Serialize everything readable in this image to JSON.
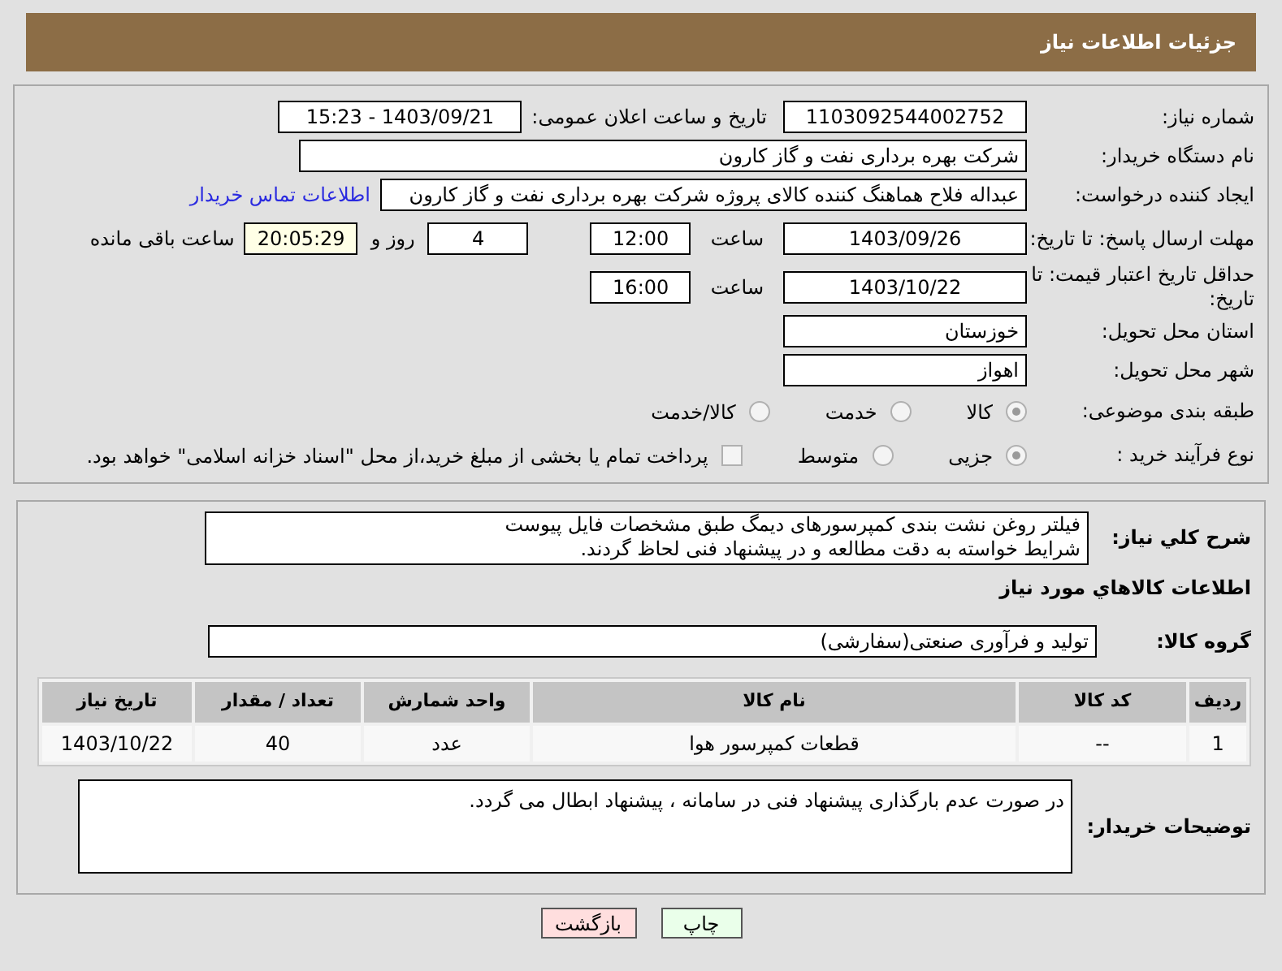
{
  "header": {
    "title": "جزئیات اطلاعات نیاز"
  },
  "need_number": {
    "label": "شماره نیاز:",
    "value": "1103092544002752"
  },
  "announce": {
    "label": "تاریخ و ساعت اعلان عمومی:",
    "value": "1403/09/21 - 15:23"
  },
  "buyer": {
    "label": "نام دستگاه خریدار:",
    "value": "شرکت بهره برداری نفت و گاز کارون"
  },
  "creator": {
    "label": "ایجاد کننده درخواست:",
    "value": "عبداله فلاح هماهنگ کننده کالای پروژه شرکت بهره برداری نفت و گاز کارون",
    "link": "اطلاعات تماس خریدار"
  },
  "deadline": {
    "label": "مهلت ارسال پاسخ: تا تاریخ:",
    "date": "1403/09/26",
    "time_label": "ساعت",
    "time": "12:00",
    "days": "4",
    "days_label": "روز و",
    "remaining": "20:05:29",
    "remaining_label": "ساعت باقی مانده"
  },
  "validity": {
    "label": "حداقل تاریخ اعتبار قیمت: تا تاریخ:",
    "date": "1403/10/22",
    "time_label": "ساعت",
    "time": "16:00"
  },
  "province": {
    "label": "استان محل تحویل:",
    "value": "خوزستان"
  },
  "city": {
    "label": "شهر محل تحویل:",
    "value": "اهواز"
  },
  "classification": {
    "label": "طبقه بندی موضوعی:",
    "options": [
      {
        "label": "کالا",
        "selected": true
      },
      {
        "label": "خدمت",
        "selected": false
      },
      {
        "label": "کالا/خدمت",
        "selected": false
      }
    ]
  },
  "process": {
    "label": "نوع فرآیند خرید :",
    "options": [
      {
        "label": "جزیی",
        "selected": true
      },
      {
        "label": "متوسط",
        "selected": false
      }
    ],
    "checkbox": {
      "label": "پرداخت تمام یا بخشی از مبلغ خرید،از محل \"اسناد خزانه اسلامی\" خواهد بود.",
      "checked": false
    }
  },
  "description": {
    "label": "شرح کلي نياز:",
    "lines": [
      "فیلتر روغن نشت بندی کمپرسورهای دیمگ طبق مشخصات فایل پیوست",
      "شرایط خواسته به دقت مطالعه و در پیشنهاد فنی لحاظ گردند."
    ]
  },
  "goods_heading": "اطلاعات کالاهاي مورد نياز",
  "goods_group": {
    "label": "گروه کالا:",
    "value": "تولید و فرآوری صنعتی(سفارشی)"
  },
  "table": {
    "columns": [
      "ردیف",
      "کد کالا",
      "نام کالا",
      "واحد شمارش",
      "تعداد / مقدار",
      "تاریخ نیاز"
    ],
    "rows": [
      [
        "1",
        "--",
        "قطعات کمپرسور هوا",
        "عدد",
        "40",
        "1403/10/22"
      ]
    ]
  },
  "buyer_notes": {
    "label": "توضیحات خریدار:",
    "value": "در صورت عدم بارگذاری پیشنهاد فنی در سامانه ، پیشنهاد ابطال می گردد."
  },
  "buttons": [
    {
      "label": "چاپ",
      "kind": "print"
    },
    {
      "label": "بازگشت",
      "kind": "back"
    }
  ]
}
